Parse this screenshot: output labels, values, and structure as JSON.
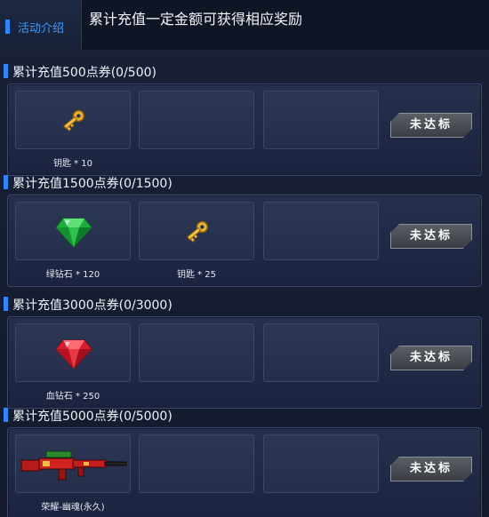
{
  "header": {
    "tab_label": "活动介绍",
    "description": "累计充值一定金额可获得相应奖励"
  },
  "sections": [
    {
      "title": "累计充值500点券(0/500)",
      "button_label": "未达标",
      "rewards": [
        {
          "icon": "key-icon",
          "label": "钥匙 * 10"
        }
      ]
    },
    {
      "title": "累计充值1500点券(0/1500)",
      "button_label": "未达标",
      "rewards": [
        {
          "icon": "green-diamond-icon",
          "label": "绿钻石 * 120"
        },
        {
          "icon": "key-icon",
          "label": "钥匙 * 25"
        }
      ]
    },
    {
      "title": "累计充值3000点券(0/3000)",
      "button_label": "未达标",
      "rewards": [
        {
          "icon": "red-diamond-icon",
          "label": "血钻石 * 250"
        }
      ]
    },
    {
      "title": "累计充值5000点券(0/5000)",
      "button_label": "未达标",
      "rewards": [
        {
          "icon": "rifle-icon",
          "label": "荣耀-幽魂(永久)"
        }
      ]
    }
  ],
  "colors": {
    "accent_blue": "#2f87ff",
    "panel_bg": "#232c49",
    "slot_bg": "#2a3452",
    "button_gray": "#4a4e55"
  }
}
